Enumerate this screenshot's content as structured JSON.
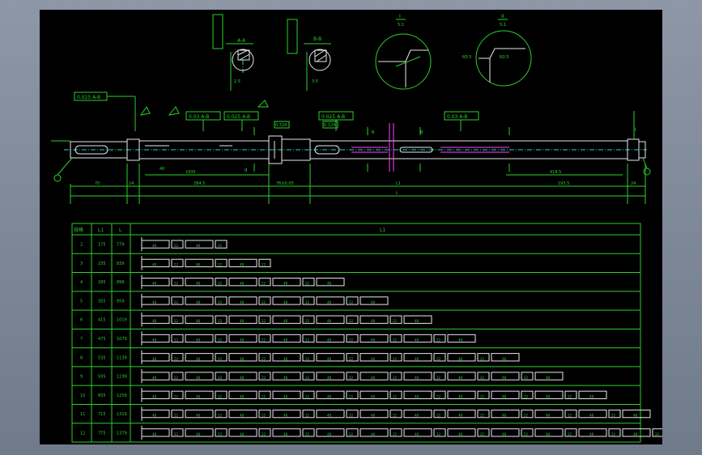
{
  "drawing": {
    "section_labels": [
      "A-A",
      "B-B"
    ],
    "detail_labels": [
      {
        "roman": "I",
        "scale": "5:1"
      },
      {
        "roman": "II",
        "scale": "5:1"
      }
    ],
    "tolerance_frames": [
      "0.025 A-B",
      "0.03 A-B",
      "0.025 A-B",
      "0.025 A-B",
      "0.03 A-B"
    ],
    "dimensions": {
      "bottom": [
        "70",
        "24",
        "284.5",
        "76±0.05",
        "L1",
        "L",
        "193.5",
        "24"
      ],
      "middle": [
        "1935",
        "418.5"
      ],
      "labels": [
        "0.324",
        "0.124",
        "40"
      ],
      "markers": [
        "II",
        "I",
        "I",
        "II"
      ]
    },
    "colors": {
      "outline": "#2bd12b",
      "part": "#e8e8e8",
      "center": "#2bd1d1",
      "thread": "#ff44ff",
      "frame_bg": "#000000"
    }
  },
  "table": {
    "headers": [
      "规格",
      "L1",
      "L",
      "L1"
    ],
    "rows": [
      {
        "spec": "2",
        "l1": "175",
        "l": "779",
        "segments": 4
      },
      {
        "spec": "3",
        "l1": "235",
        "l": "839",
        "segments": 6
      },
      {
        "spec": "4",
        "l1": "295",
        "l": "899",
        "segments": 9
      },
      {
        "spec": "5",
        "l1": "355",
        "l": "959",
        "segments": 11
      },
      {
        "spec": "6",
        "l1": "415",
        "l": "1019",
        "segments": 13
      },
      {
        "spec": "7",
        "l1": "475",
        "l": "1079",
        "segments": 15
      },
      {
        "spec": "8",
        "l1": "535",
        "l": "1139",
        "segments": 17
      },
      {
        "spec": "9",
        "l1": "595",
        "l": "1199",
        "segments": 19
      },
      {
        "spec": "10",
        "l1": "655",
        "l": "1259",
        "segments": 21
      },
      {
        "spec": "11",
        "l1": "715",
        "l": "1319",
        "segments": 23
      },
      {
        "spec": "12",
        "l1": "775",
        "l": "1379",
        "segments": 25
      }
    ],
    "segment_labels": [
      "48",
      "22",
      "40",
      "25"
    ]
  }
}
